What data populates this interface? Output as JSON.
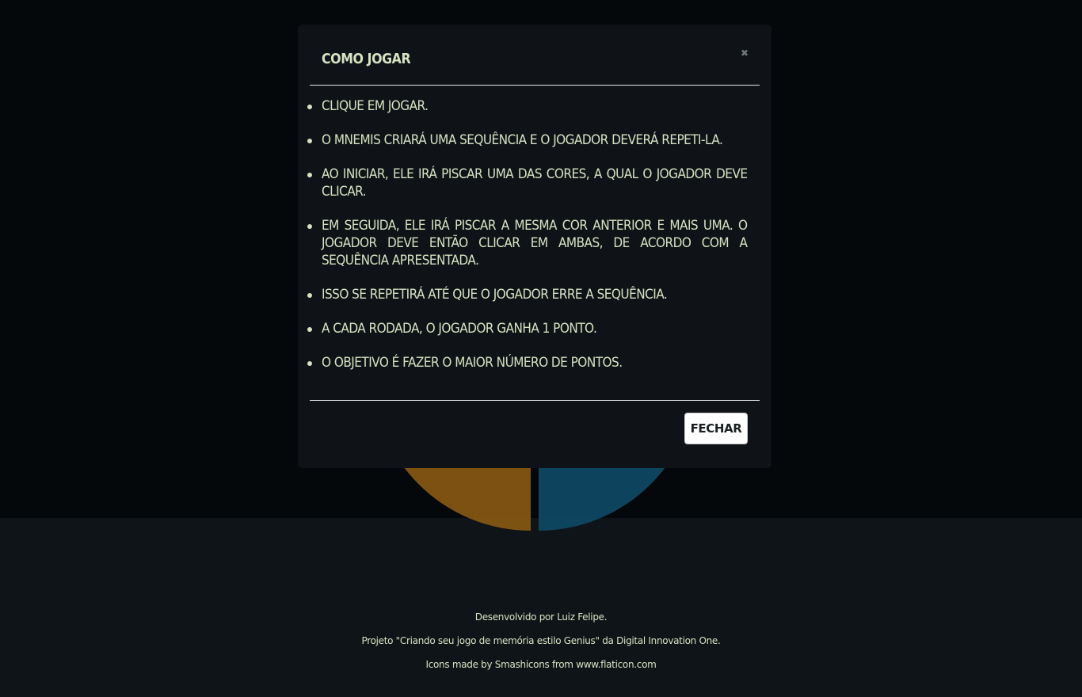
{
  "modal": {
    "title": "COMO JOGAR",
    "close_icon": "close-icon",
    "rules": [
      "CLIQUE EM JOGAR.",
      "O MNEMIS CRIARÁ UMA SEQUÊNCIA E O JOGADOR DEVERÁ REPETI-LA.",
      "AO INICIAR, ELE IRÁ PISCAR UMA DAS CORES, A QUAL O JOGADOR DEVE CLICAR.",
      "EM SEGUIDA, ELE IRÁ PISCAR A MESMA COR ANTERIOR E MAIS UMA. O JOGADOR DEVE ENTÃO CLICAR EM AMBAS, DE ACORDO COM A SEQUÊNCIA APRESENTADA.",
      "ISSO SE REPETIRÁ ATÉ QUE O JOGADOR ERRE A SEQUÊNCIA.",
      "A CADA RODADA, O JOGADOR GANHA 1 PONTO.",
      "O OBJETIVO É FAZER O MAIOR NÚMERO DE PONTOS."
    ],
    "close_button_label": "FECHAR"
  },
  "board": {
    "colors": {
      "yellow": "#8a5a12",
      "blue": "#0e4a66"
    }
  },
  "footer": {
    "line1": "Desenvolvido por Luiz Felipe.",
    "line2": "Projeto \"Criando seu jogo de memória estilo Genius\" da Digital Innovation One.",
    "line3": "Icons made by Smashicons from www.flaticon.com"
  },
  "colors": {
    "background": "#05080b",
    "modal_bg": "#0f1317",
    "text": "#d7e2c2",
    "button_bg": "#ffffff"
  }
}
